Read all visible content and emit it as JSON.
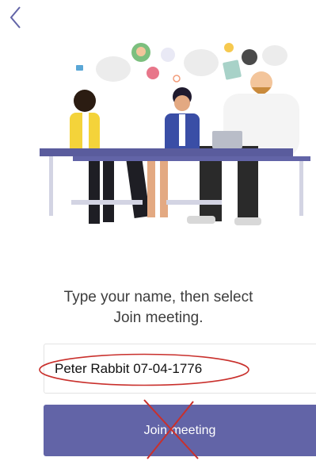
{
  "icons": {
    "back": "chevron-left-icon"
  },
  "colors": {
    "accent": "#6264a7",
    "annotation_red": "#c9302c"
  },
  "prompt": {
    "line1": "Type your name, then select",
    "line2": "Join meeting."
  },
  "name_field": {
    "value": "Peter Rabbit 07-04-1776"
  },
  "join_button": {
    "label": "Join meeting"
  }
}
